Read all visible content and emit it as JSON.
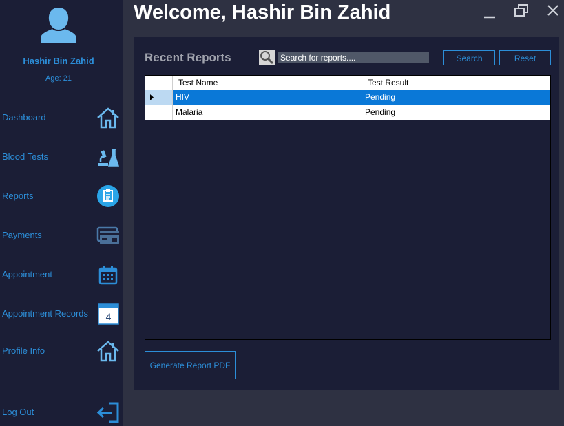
{
  "window": {
    "title": "Welcome, Hashir Bin Zahid"
  },
  "user": {
    "name": "Hashir Bin Zahid",
    "age": "Age: 21"
  },
  "sidebar": {
    "items": [
      {
        "label": "Dashboard",
        "icon": "home-icon"
      },
      {
        "label": "Blood Tests",
        "icon": "lab-flask-icon"
      },
      {
        "label": "Reports",
        "icon": "clipboard-icon"
      },
      {
        "label": "Payments",
        "icon": "credit-card-icon"
      },
      {
        "label": "Appointment",
        "icon": "calendar-icon"
      },
      {
        "label": "Appointment Records",
        "icon": "calendar-day-icon",
        "icon_text": "4"
      },
      {
        "label": "Profile Info",
        "icon": "home-icon"
      },
      {
        "label": "Log Out",
        "icon": "logout-icon"
      }
    ]
  },
  "panel": {
    "title": "Recent Reports",
    "search": {
      "placeholder": "Search for reports....",
      "value": ""
    },
    "search_button": "Search",
    "reset_button": "Reset",
    "table": {
      "columns": [
        "Test Name",
        "Test Result"
      ],
      "rows": [
        {
          "test_name": "HIV",
          "test_result": "Pending",
          "selected": true
        },
        {
          "test_name": "Malaria",
          "test_result": "Pending",
          "selected": false
        }
      ]
    },
    "generate_button": "Generate Report PDF"
  },
  "colors": {
    "accent": "#2c8ed8",
    "sidebar_bg": "#1b1e36",
    "page_bg": "#2e3142",
    "selection": "#0a78d7"
  }
}
